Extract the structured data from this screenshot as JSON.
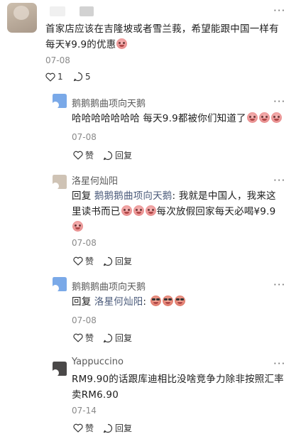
{
  "top_comment": {
    "text_line1": "首家店应该在吉隆坡或者雪兰莪，希望能跟中国一样有",
    "text_line2": "每天¥9.9的优惠",
    "date": "07-08",
    "likes": "1",
    "replies": "5"
  },
  "replies": [
    {
      "author": "鹅鹅鹅曲项向天鹅",
      "line1": "哈哈哈哈哈哈哈 每天9.9都被你们知道了",
      "date": "07-08",
      "like_label": "赞",
      "reply_label": "回复"
    },
    {
      "author": "洛星何灿阳",
      "reply_prefix": "回复 ",
      "mention": "鹅鹅鹅曲项向天鹅",
      "line1_rest": ": 我就是中国人，我来这",
      "line2_a": "里读书而已",
      "line2_b": "每次放假回家每天必喝¥9.9",
      "date": "07-08",
      "like_label": "赞",
      "reply_label": "回复"
    },
    {
      "author": "鹅鹅鹅曲项向天鹅",
      "reply_prefix": "回复 ",
      "mention": "洛星何灿阳",
      "line1_rest": ": ",
      "date": "07-08",
      "like_label": "赞",
      "reply_label": "回复"
    },
    {
      "author": "Yappuccino",
      "line1": "RM9.90的话跟库迪相比没啥竞争力除非按照汇率",
      "line2": "卖RM6.90",
      "date": "07-14",
      "like_label": "赞",
      "reply_label": "回复"
    }
  ],
  "more_glyph": "···",
  "colors": {
    "avatar_blue": "#7aa9e8",
    "avatar_beige": "#cfc3b5",
    "avatar_dark": "#4a4848"
  },
  "icons": [
    "more-icon",
    "heart-icon",
    "comment-icon",
    "emoji-icon"
  ]
}
